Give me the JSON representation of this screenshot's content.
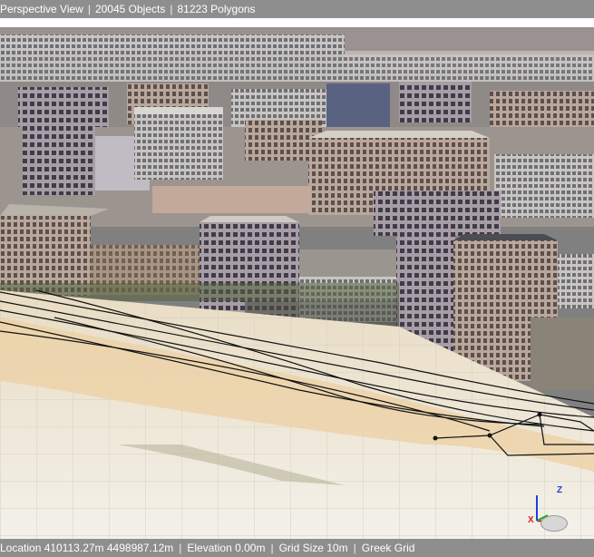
{
  "viewport_header": {
    "view_name": "Perspective View",
    "objects": "20045 Objects",
    "polygons": "81223 Polygons"
  },
  "status_bar": {
    "location": "Location 410113.27m 4498987.12m",
    "elevation": "Elevation 0.00m",
    "grid_size": "Grid Size 10m",
    "grid_type": "Greek Grid"
  },
  "axis_gizmo": {
    "z_label": "Z",
    "x_label": "X",
    "z_color": "#1f3fd8",
    "x_color": "#d81f1f",
    "y_color": "#1fa81f"
  },
  "colors": {
    "header_bg": "#8e8e8e",
    "sky": "#ffffff",
    "ground": "#e8e2d0",
    "road_fill": "#ecd2a8",
    "wire": "#111111"
  },
  "icons": {
    "nav_compass": "compass-icon"
  }
}
